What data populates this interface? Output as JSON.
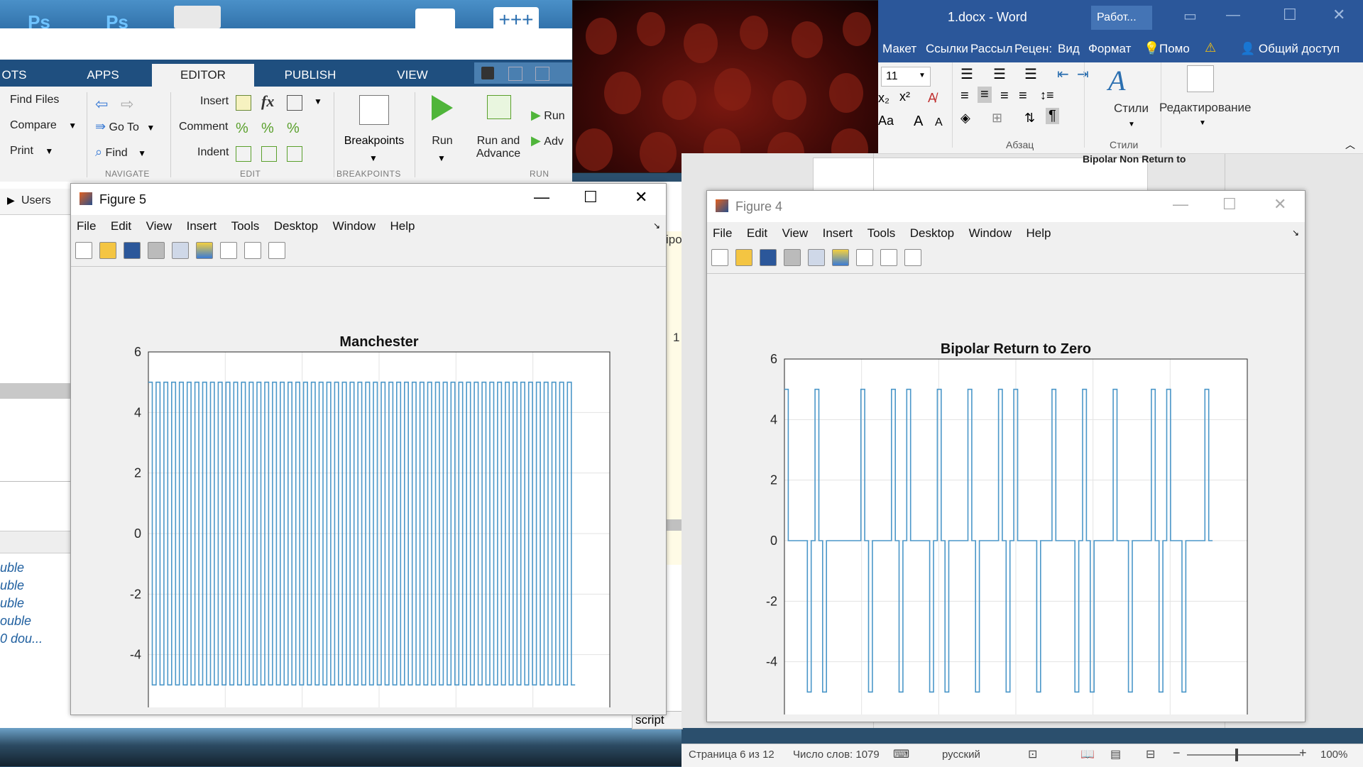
{
  "desktop": {
    "ps_label": "Ps"
  },
  "matlab": {
    "tabs": [
      "OTS",
      "APPS",
      "EDITOR",
      "PUBLISH",
      "VIEW"
    ],
    "active_tab": "EDITOR",
    "toolbar": {
      "find_files": "Find Files",
      "compare": "Compare",
      "print": "Print",
      "go_to": "Go To",
      "find": "Find",
      "insert": "Insert",
      "comment": "Comment",
      "indent": "Indent",
      "breakpoints": "Breakpoints",
      "run": "Run",
      "run_and_advance": "Run and\nAdvance",
      "run_section": "Run",
      "advance": "Adv"
    },
    "groups": {
      "navigate": "NAVIGATE",
      "edit": "EDIT",
      "breakpoints": "BREAKPOINTS",
      "run": "RUN"
    },
    "breadcrumb": "Users",
    "workspace_types": [
      "uble",
      "uble",
      "uble",
      "ouble",
      "0 dou..."
    ],
    "editor_partial": "ipo",
    "line_number": "1",
    "status_script": "script"
  },
  "figure5": {
    "title": "Figure 5",
    "menu": [
      "File",
      "Edit",
      "View",
      "Insert",
      "Tools",
      "Desktop",
      "Window",
      "Help"
    ]
  },
  "figure4": {
    "title": "Figure 4",
    "menu": [
      "File",
      "Edit",
      "View",
      "Insert",
      "Tools",
      "Desktop",
      "Window",
      "Help"
    ]
  },
  "chart_data": [
    {
      "type": "line",
      "title": "Manchester",
      "xlabel": "",
      "ylabel": "",
      "xlim": [
        0,
        12000
      ],
      "ylim": [
        -6,
        6
      ],
      "xticks": [
        0,
        2000,
        4000,
        6000,
        8000,
        10000,
        12000
      ],
      "yticks": [
        -6,
        -4,
        -2,
        0,
        2,
        4,
        6
      ],
      "grid": true,
      "color": "#4b97c9",
      "levels": [
        -5,
        5
      ],
      "x_range": [
        0,
        11100
      ],
      "transitions": 110
    },
    {
      "type": "line",
      "title": "Bipolar Return to Zero",
      "xlabel": "",
      "ylabel": "",
      "xlim": [
        0,
        12000
      ],
      "ylim": [
        -6,
        6
      ],
      "xticks": [
        0,
        2000,
        4000,
        6000,
        8000,
        10000,
        12000
      ],
      "yticks": [
        -6,
        -4,
        -2,
        0,
        2,
        4,
        6
      ],
      "grid": true,
      "color": "#4b97c9",
      "levels": [
        -5,
        0,
        5
      ],
      "x_range": [
        0,
        11100
      ],
      "bits": [
        1,
        0,
        0,
        1,
        1,
        1,
        0,
        0,
        0,
        0,
        1,
        1,
        0,
        0,
        1,
        1,
        1,
        0,
        0,
        1,
        1,
        1,
        0,
        0,
        1,
        1,
        0,
        0,
        1,
        1,
        1,
        0,
        0,
        1,
        0,
        1,
        0,
        0,
        1,
        1,
        1,
        0,
        0,
        1,
        0,
        1,
        0,
        0,
        1,
        1,
        1,
        0,
        1,
        0,
        0,
        1
      ]
    }
  ],
  "word": {
    "title": "1.docx - Word",
    "title_right": "Работ...",
    "menu": [
      "Макет",
      "Ссылки",
      "Рассыл",
      "Рецен:",
      "Вид",
      "Формат"
    ],
    "help": "Помо",
    "share": "Общий доступ",
    "font_size": "11",
    "group_paragraph": "Абзац",
    "group_styles": "Стили",
    "styles_label": "Стили",
    "editing_label": "Редактирование",
    "hidden_heading": "Bipolar Non Return to Zero",
    "status": {
      "page": "Страница 6 из 12",
      "words": "Число слов: 1079",
      "lang": "русский",
      "zoom": "100%"
    }
  }
}
